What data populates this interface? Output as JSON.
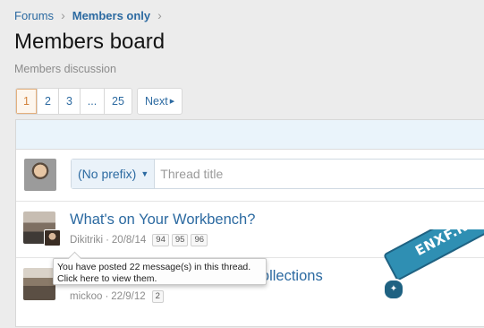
{
  "breadcrumb": {
    "items": [
      "Forums",
      "Members only"
    ],
    "separator": "›"
  },
  "page": {
    "title": "Members board",
    "subtitle": "Members discussion"
  },
  "pagination": {
    "pages": [
      "1",
      "2",
      "3",
      "...",
      "25"
    ],
    "current": "1",
    "next_label": "Next"
  },
  "new_thread": {
    "prefix_label": "(No prefix)",
    "title_placeholder": "Thread title"
  },
  "threads": [
    {
      "title": "What's on Your Workbench?",
      "author": "Dikitriki",
      "date": "20/8/14",
      "pages": [
        "94",
        "95",
        "96"
      ]
    },
    {
      "title": "Collections",
      "author": "mickoo",
      "date": "22/9/12",
      "pages": [
        "2"
      ]
    }
  ],
  "tooltip": {
    "line1": "You have posted 22 message(s) in this thread.",
    "line2": "Click here to view them."
  },
  "watermark": {
    "text": "ENXF.NET"
  },
  "colors": {
    "link": "#2c6aa1",
    "current_page": "#d2813a",
    "header_band": "#eaf4fb",
    "background": "#ececec"
  }
}
